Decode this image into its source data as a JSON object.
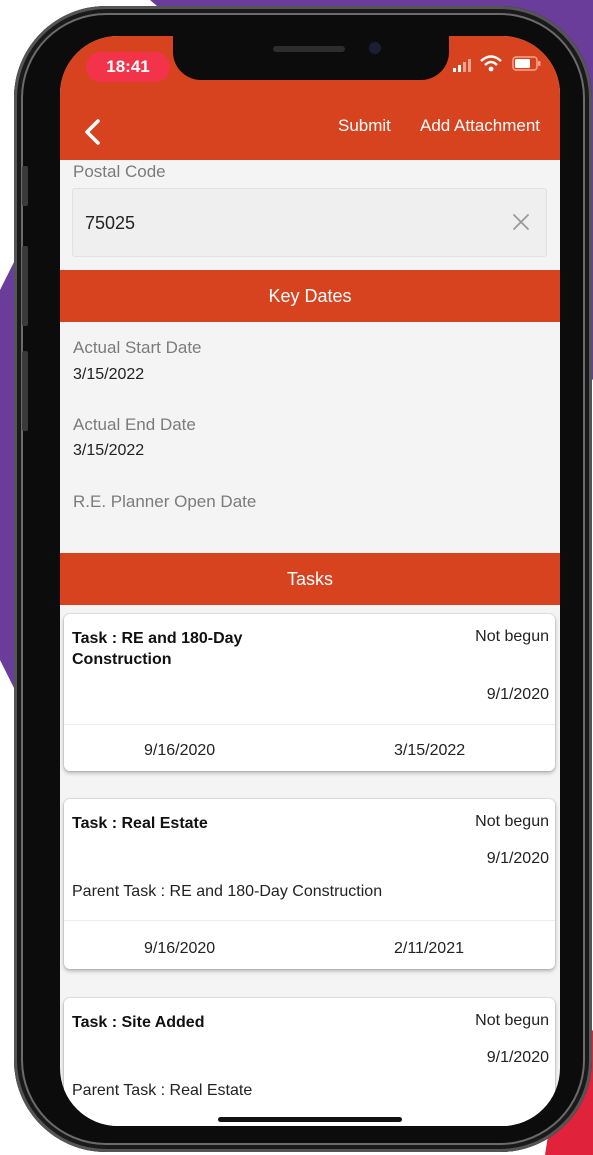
{
  "colors": {
    "brand": "#d8431f",
    "time_pill": "#f2334a",
    "bg_purple": "#6a3d9a",
    "bg_red": "#e0233a"
  },
  "status_bar": {
    "time": "18:41"
  },
  "app_bar": {
    "submit_label": "Submit",
    "add_attachment_label": "Add Attachment",
    "back_icon": "chevron-left-icon"
  },
  "postal_code": {
    "label": "Postal Code",
    "value": "75025",
    "clear_icon": "close-icon"
  },
  "key_dates": {
    "header": "Key Dates",
    "actual_start_label": "Actual Start Date",
    "actual_start_value": "3/15/2022",
    "actual_end_label": "Actual End Date",
    "actual_end_value": "3/15/2022",
    "planner_open_label": "R.E. Planner Open Date"
  },
  "tasks": {
    "header": "Tasks",
    "items": [
      {
        "title": "Task : RE and 180-Day Construction",
        "status": "Not begun",
        "date": "9/1/2020",
        "parent": "",
        "start": "9/16/2020",
        "end": "3/15/2022"
      },
      {
        "title": "Task : Real Estate",
        "status": "Not begun",
        "date": "9/1/2020",
        "parent": "Parent Task : RE and 180-Day Construction",
        "start": "9/16/2020",
        "end": "2/11/2021"
      },
      {
        "title": "Task : Site Added",
        "status": "Not begun",
        "date": "9/1/2020",
        "parent": "Parent Task : Real Estate"
      }
    ]
  }
}
